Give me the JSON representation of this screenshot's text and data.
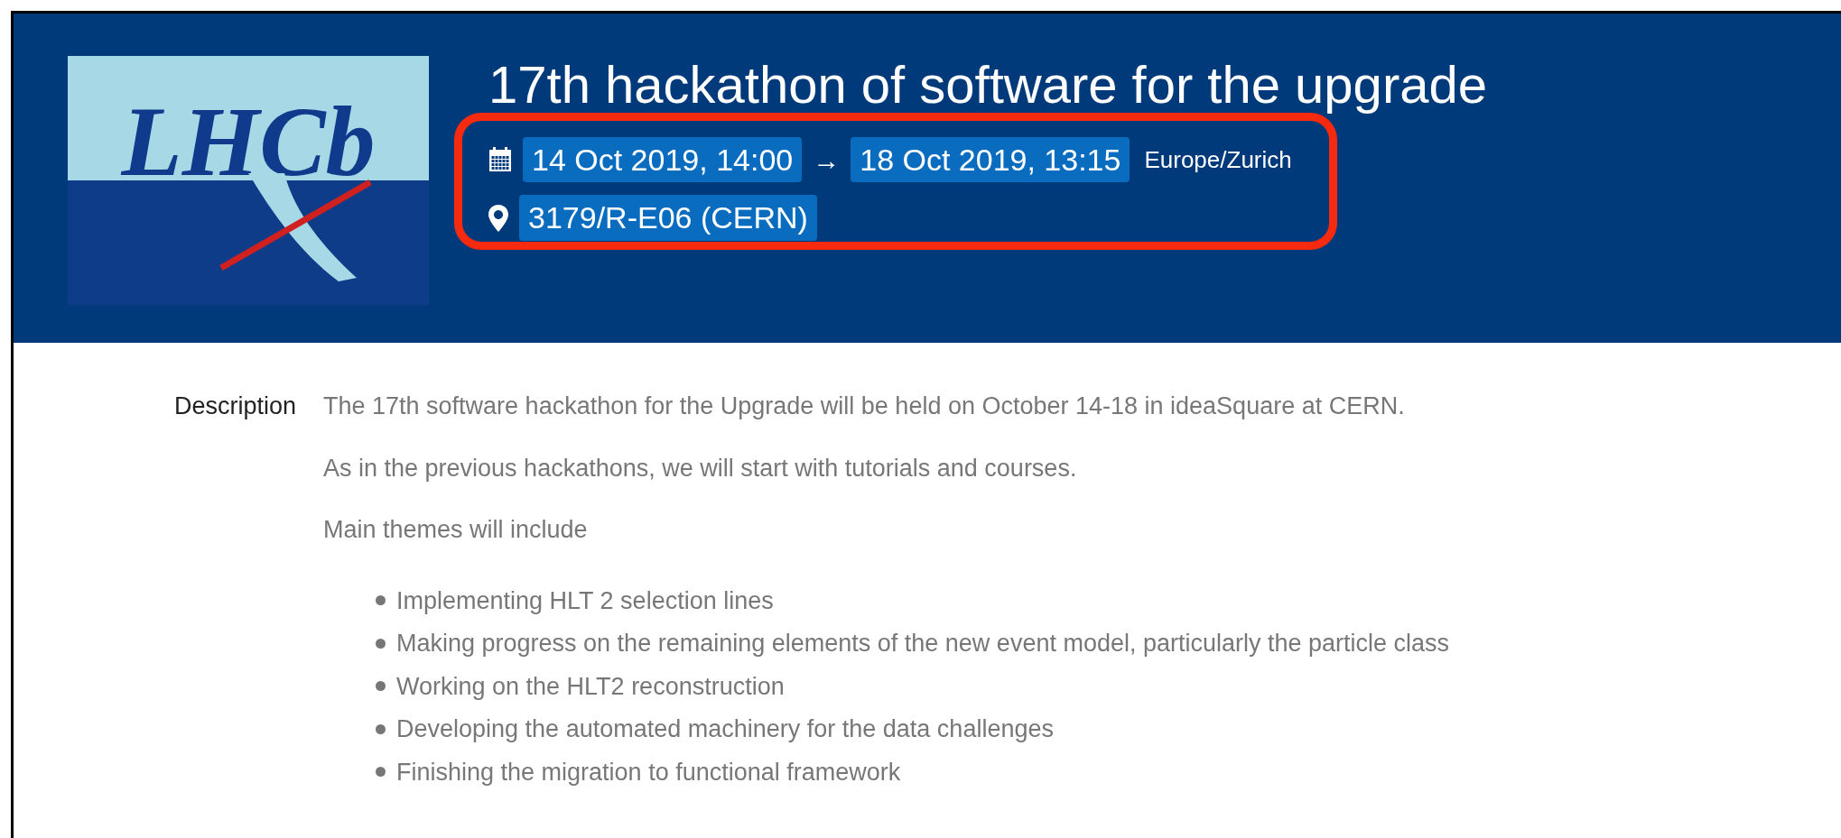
{
  "header": {
    "logo_text": "LHCb",
    "title": "17th hackathon of software for the upgrade",
    "start": "14 Oct 2019, 14:00",
    "arrow": "→",
    "end": "18 Oct 2019, 13:15",
    "timezone": "Europe/Zurich",
    "location": "3179/R-E06 (CERN)"
  },
  "details": {
    "label": "Description",
    "paragraphs": [
      "The 17th software hackathon for the Upgrade will be held on October 14-18 in ideaSquare at CERN.",
      "As in the previous hackathons, we will start with tutorials and courses.",
      "Main themes will include"
    ],
    "themes": [
      "Implementing HLT 2 selection lines",
      "Making progress on the remaining elements of the new event model, particularly the particle class",
      "Working on the HLT2 reconstruction",
      "Developing the automated machinery for the data challenges",
      "Finishing the migration to functional framework"
    ]
  }
}
